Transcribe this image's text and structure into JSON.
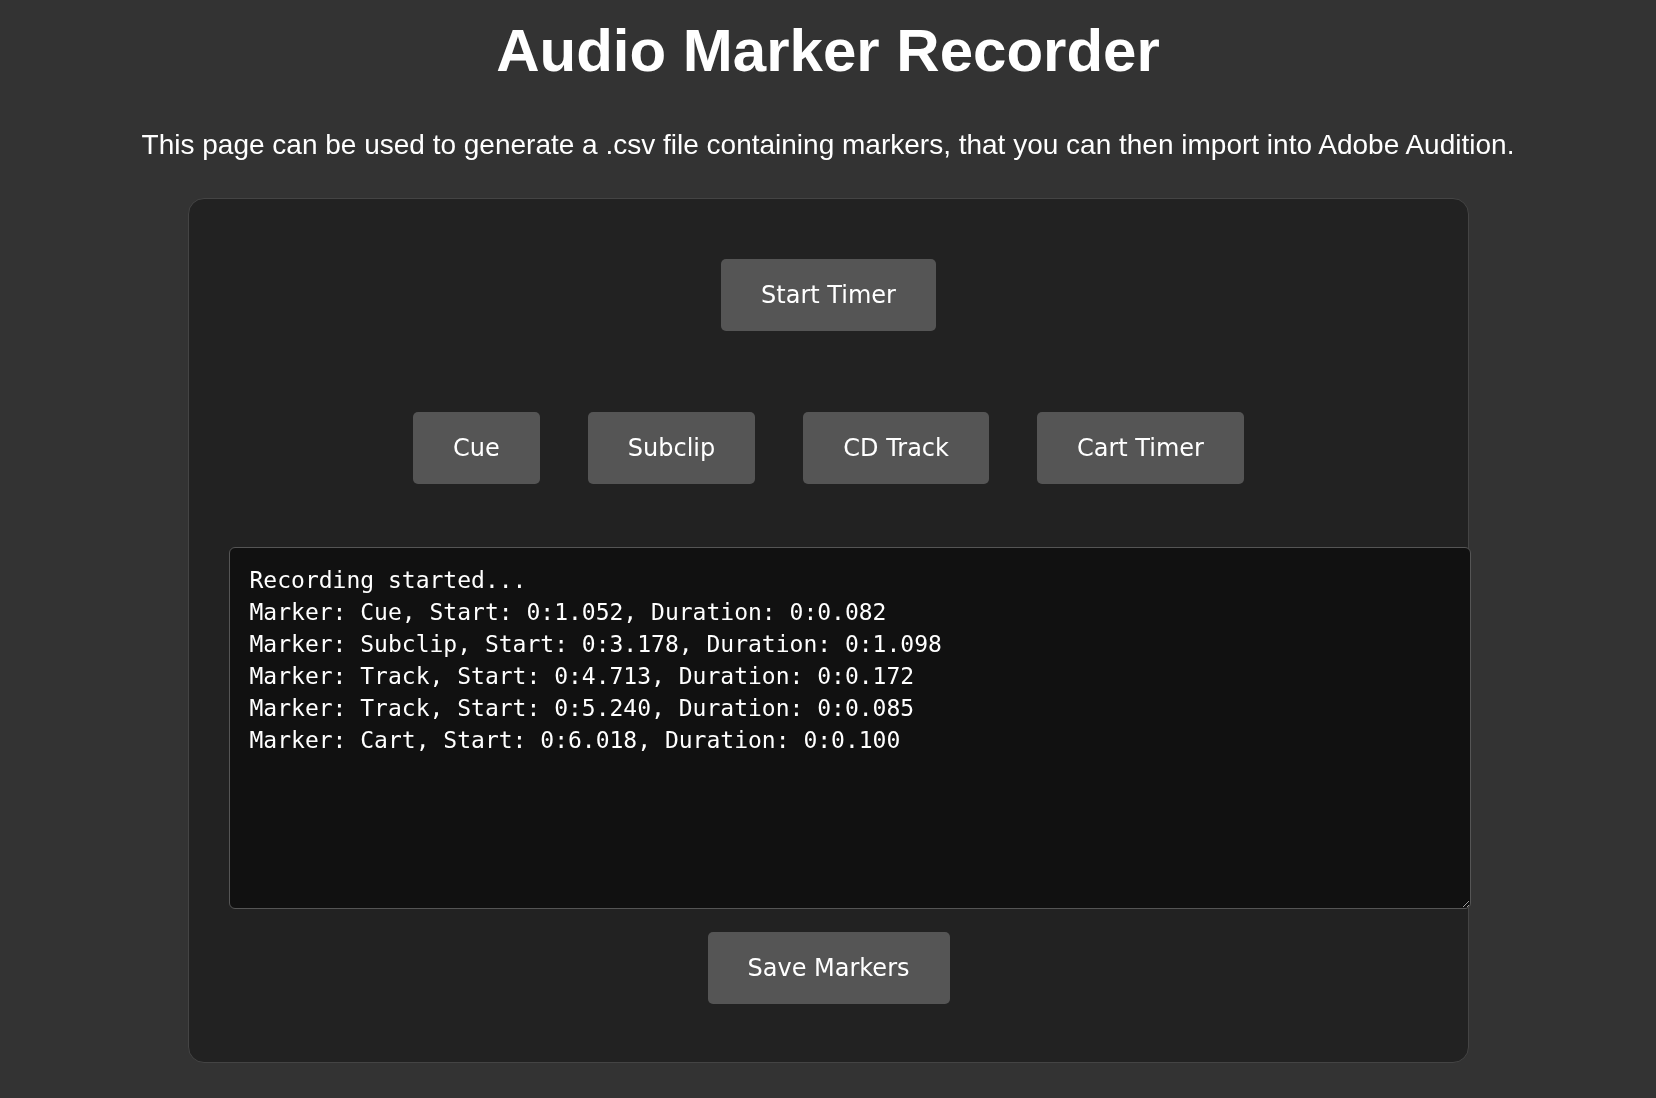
{
  "title": "Audio Marker Recorder",
  "description": "This page can be used to generate a .csv file containing markers, that you can then import into Adobe Audition.",
  "start_button": "Start Timer",
  "marker_buttons": [
    "Cue",
    "Subclip",
    "CD Track",
    "Cart Timer"
  ],
  "log": [
    "Recording started...",
    "Marker: Cue, Start: 0:1.052, Duration: 0:0.082",
    "Marker: Subclip, Start: 0:3.178, Duration: 0:1.098",
    "Marker: Track, Start: 0:4.713, Duration: 0:0.172",
    "Marker: Track, Start: 0:5.240, Duration: 0:0.085",
    "Marker: Cart, Start: 0:6.018, Duration: 0:0.100"
  ],
  "save_button": "Save Markers"
}
